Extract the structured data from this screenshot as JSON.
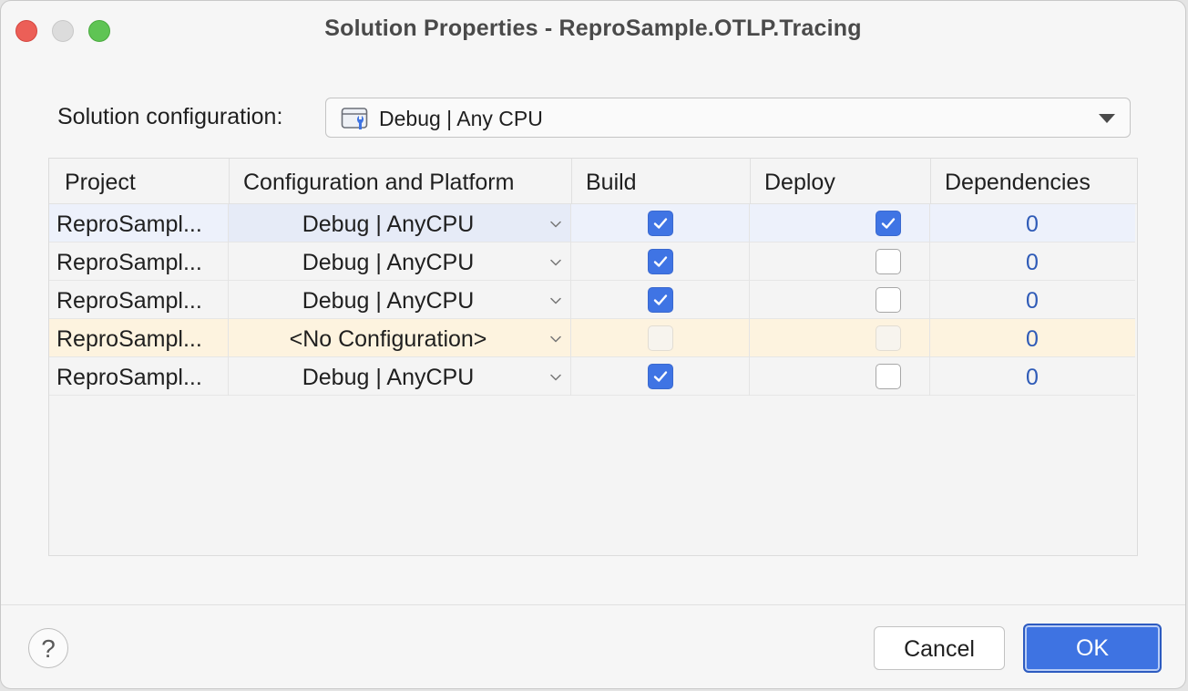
{
  "window": {
    "title": "Solution Properties - ReproSample.OTLP.Tracing"
  },
  "solution_config": {
    "label": "Solution configuration:",
    "value": "Debug | Any CPU",
    "icon": "config-wrench-icon"
  },
  "grid": {
    "headers": {
      "project": "Project",
      "config": "Configuration and Platform",
      "build": "Build",
      "deploy": "Deploy",
      "deps": "Dependencies"
    },
    "rows": [
      {
        "project": "ReproSampl...",
        "config": "Debug | AnyCPU",
        "build": "checked",
        "deploy": "checked",
        "deps": "0",
        "state": "selected"
      },
      {
        "project": "ReproSampl...",
        "config": "Debug | AnyCPU",
        "build": "checked",
        "deploy": "unchecked",
        "deps": "0",
        "state": "normal"
      },
      {
        "project": "ReproSampl...",
        "config": "Debug | AnyCPU",
        "build": "checked",
        "deploy": "unchecked",
        "deps": "0",
        "state": "normal"
      },
      {
        "project": "ReproSampl...",
        "config": "<No Configuration>",
        "build": "disabled",
        "deploy": "disabled",
        "deps": "0",
        "state": "warning"
      },
      {
        "project": "ReproSampl...",
        "config": "Debug | AnyCPU",
        "build": "checked",
        "deploy": "unchecked",
        "deps": "0",
        "state": "normal"
      }
    ]
  },
  "buttons": {
    "help": "?",
    "cancel": "Cancel",
    "ok": "OK"
  },
  "colors": {
    "accent": "#3e73e2",
    "selected_row": "#edf1fb",
    "warning_row": "#fdf3df",
    "link": "#2f5bb7"
  }
}
